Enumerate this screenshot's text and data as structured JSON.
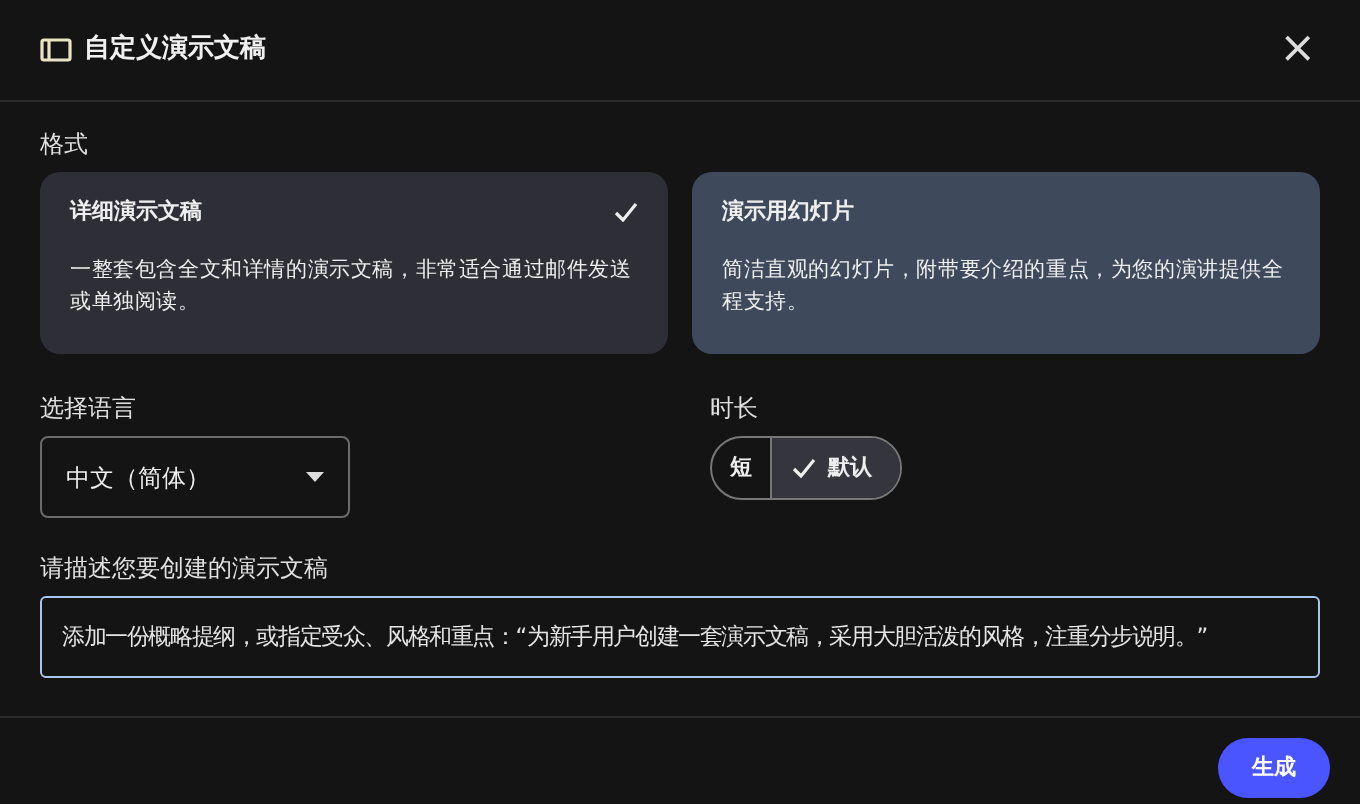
{
  "dialog": {
    "title": "自定义演示文稿",
    "close": "×"
  },
  "format": {
    "label": "格式",
    "options": [
      {
        "title": "详细演示文稿",
        "description": "一整套包含全文和详情的演示文稿，非常适合通过邮件发送或单独阅读。",
        "selected": true,
        "hovered": false
      },
      {
        "title": "演示用幻灯片",
        "description": "简洁直观的幻灯片，附带要介绍的重点，为您的演讲提供全程支持。",
        "selected": false,
        "hovered": true
      }
    ]
  },
  "language": {
    "label": "选择语言",
    "value": "中文（简体）"
  },
  "duration": {
    "label": "时长",
    "options": [
      {
        "label": "短",
        "selected": false
      },
      {
        "label": "默认",
        "selected": true
      }
    ]
  },
  "description": {
    "label": "请描述您要创建的演示文稿",
    "placeholder": "添加一份概略提纲，或指定受众、风格和重点：“为新手用户创建一套演示文稿，采用大胆活泼的风格，注重分步说明。”"
  },
  "buttons": [
    {
      "label": "生成"
    }
  ]
}
